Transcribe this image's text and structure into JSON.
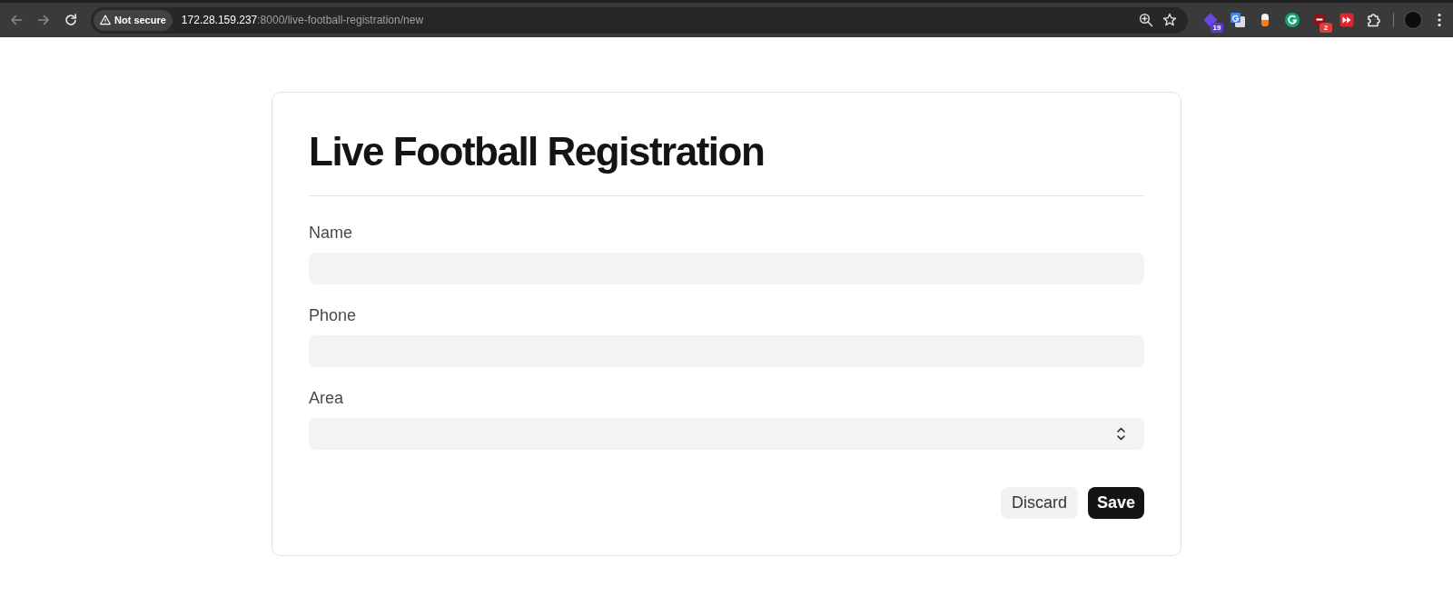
{
  "browser": {
    "back": {
      "disabled": true
    },
    "forward": {
      "disabled": true
    },
    "security_chip": "Not secure",
    "url": {
      "host": "172.28.159.237",
      "path": ":8000/live-football-registration/new"
    },
    "extensions": [
      {
        "kind": "diamond",
        "badge": "19"
      },
      {
        "kind": "translate"
      },
      {
        "kind": "capsule"
      },
      {
        "kind": "letter"
      },
      {
        "kind": "shield",
        "badge": "2"
      },
      {
        "kind": "fastforward"
      }
    ]
  },
  "form": {
    "title": "Live Football Registration",
    "fields": [
      {
        "label": "Name",
        "kind": "text"
      },
      {
        "label": "Phone",
        "kind": "text"
      },
      {
        "label": "Area",
        "kind": "select"
      }
    ],
    "buttons": [
      {
        "label": "Discard",
        "kind": "secondary"
      },
      {
        "label": "Save",
        "kind": "primary"
      }
    ]
  }
}
